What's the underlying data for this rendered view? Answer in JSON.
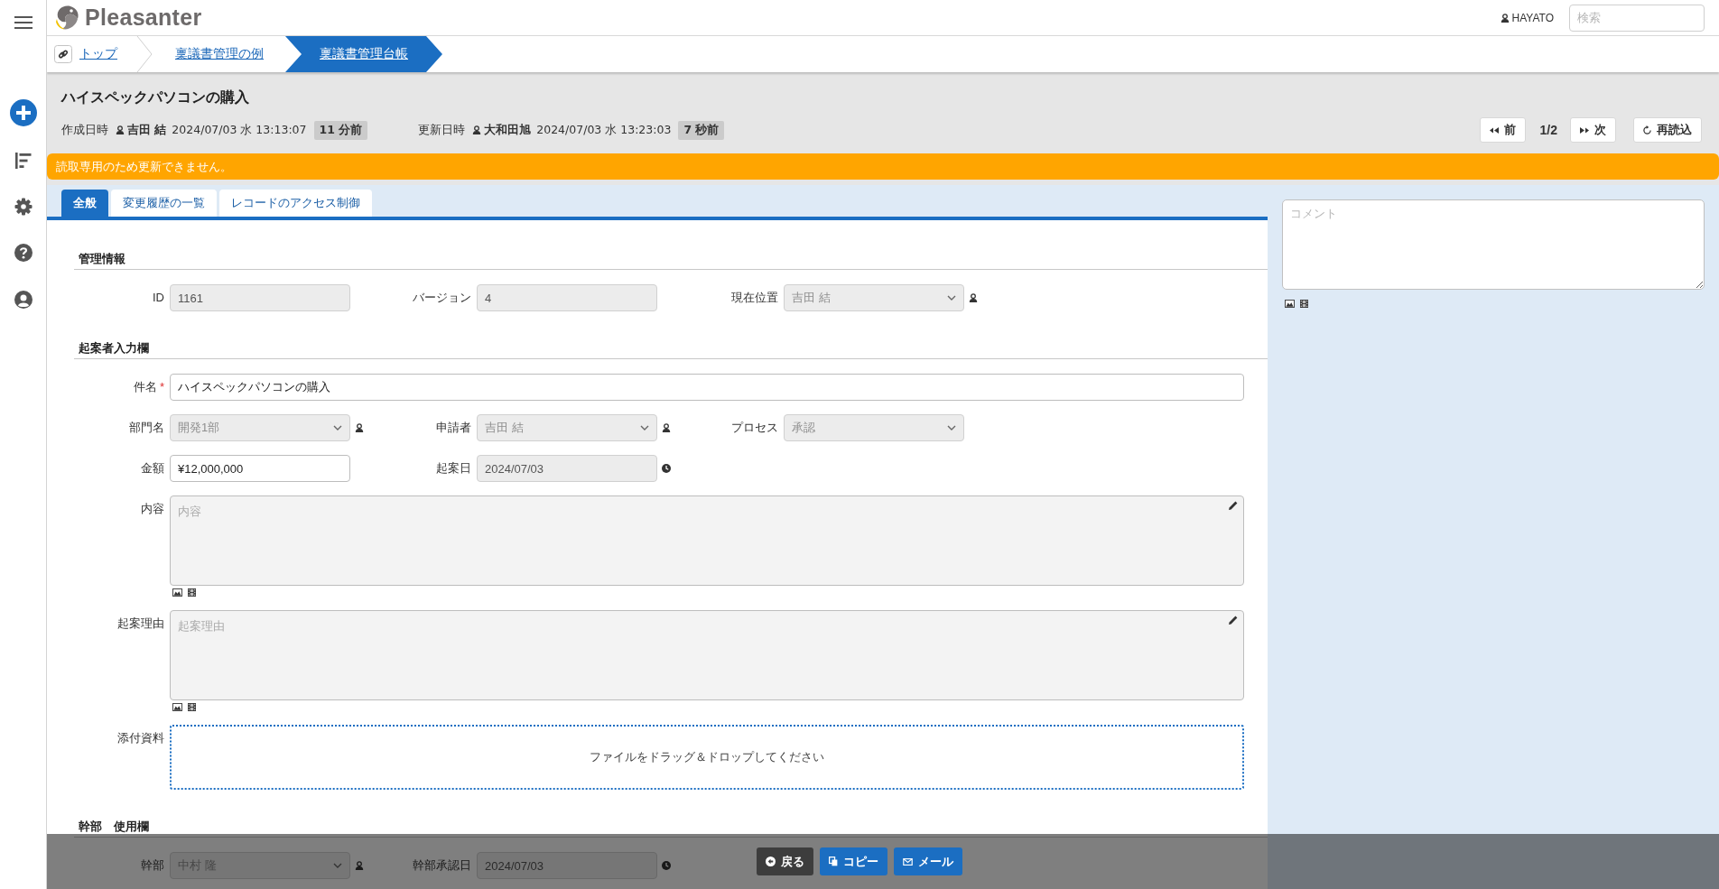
{
  "header": {
    "logo": "Pleasanter",
    "user": "HAYATO",
    "search": {
      "placeholder": "検索"
    }
  },
  "breadcrumbs": [
    {
      "label": "トップ",
      "selected": false
    },
    {
      "label": "稟議書管理の例",
      "selected": false
    },
    {
      "label": "稟議書管理台帳",
      "selected": true
    }
  ],
  "record": {
    "title": "ハイスペックパソコンの購入",
    "meta": [
      {
        "label": "作成日時",
        "user": "吉田 結",
        "datetime": "2024/07/03 水 13:13:07",
        "elapsed": "11 分前"
      },
      {
        "label": "更新日時",
        "user": "大和田旭",
        "datetime": "2024/07/03 水 13:23:03",
        "elapsed": "7 秒前"
      }
    ]
  },
  "pager": {
    "prev": "前",
    "position": "1/2",
    "next": "次",
    "reload": "再読込"
  },
  "notice": "読取専用のため更新できません。",
  "tabs": [
    {
      "label": "全般",
      "selected": true
    },
    {
      "label": "変更履歴の一覧",
      "selected": false
    },
    {
      "label": "レコードのアクセス制御",
      "selected": false
    }
  ],
  "sections": [
    {
      "title": "管理情報",
      "rows": [
        [
          {
            "kind": "text",
            "label": "ID",
            "value": "1161",
            "disabled": true
          },
          {
            "kind": "text",
            "label": "バージョン",
            "value": "4",
            "disabled": true
          },
          {
            "kind": "user-select",
            "label": "現在位置",
            "value": "吉田 結",
            "disabled": true
          }
        ]
      ]
    },
    {
      "title": "起案者入力欄",
      "rows": [
        [
          {
            "kind": "text",
            "label": "件名",
            "required_mark": "*",
            "value": "ハイスペックパソコンの購入",
            "disabled": false
          }
        ],
        [
          {
            "kind": "user-select",
            "label": "部門名",
            "value": "開発1部",
            "disabled": true
          },
          {
            "kind": "user-select",
            "label": "申請者",
            "value": "吉田 結",
            "disabled": true
          },
          {
            "kind": "select",
            "label": "プロセス",
            "value": "承認",
            "disabled": true
          }
        ],
        [
          {
            "kind": "text",
            "label": "金額",
            "value": "¥12,000,000",
            "disabled": false
          },
          {
            "kind": "date",
            "label": "起案日",
            "value": "2024/07/03",
            "disabled": true
          }
        ],
        [
          {
            "kind": "textarea",
            "label": "内容",
            "placeholder": "内容",
            "disabled": true
          }
        ],
        [
          {
            "kind": "textarea",
            "label": "起案理由",
            "placeholder": "起案理由",
            "disabled": true
          }
        ],
        [
          {
            "kind": "dropzone",
            "label": "添付資料",
            "hint": "ファイルをドラッグ＆ドロップしてください"
          }
        ]
      ]
    },
    {
      "title": "幹部　使用欄",
      "rows": [
        [
          {
            "kind": "user-select",
            "label": "幹部",
            "value": "中村 隆",
            "disabled": true
          },
          {
            "kind": "date",
            "label": "幹部承認日",
            "value": "2024/07/03",
            "disabled": true
          }
        ]
      ]
    }
  ],
  "comment": {
    "placeholder": "コメント"
  },
  "actions": [
    {
      "kind": "back",
      "label": "戻る"
    },
    {
      "kind": "copy",
      "label": "コピー"
    },
    {
      "kind": "mail",
      "label": "メール"
    }
  ]
}
